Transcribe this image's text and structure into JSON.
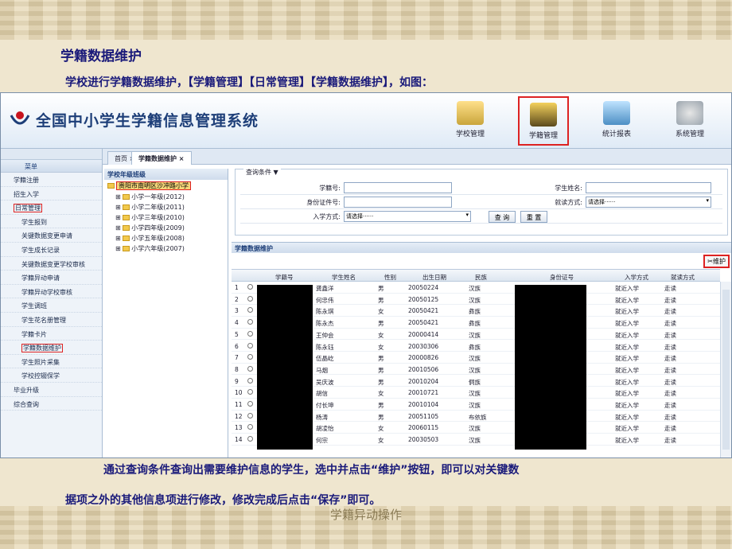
{
  "slide": {
    "title": "学籍数据维护",
    "subtitle": "学校进行学籍数据维护，【学籍管理】【日常管理】【学籍数据维护】，如图：",
    "body_line1": "通过查询条件查询出需要维护信息的学生，选中并点击“维护”按钮，即可以对关键数",
    "body_line2": "据项之外的其他信息项进行修改，修改完成后点击“保存”即可。",
    "footer": "学籍异动操作"
  },
  "app": {
    "title": "全国中小学生学籍信息管理系统",
    "top_nav": [
      {
        "label": "学校管理",
        "icon": "school-icon",
        "active": false
      },
      {
        "label": "学籍管理",
        "icon": "records-box-icon",
        "active": true
      },
      {
        "label": "统计报表",
        "icon": "stats-icon",
        "active": false
      },
      {
        "label": "系统管理",
        "icon": "settings-icon",
        "active": false
      }
    ],
    "tabs": [
      {
        "label": "首页"
      },
      {
        "label": "学籍数据维护"
      }
    ],
    "left_menu": {
      "title": "菜单",
      "items": [
        {
          "label": "学籍注册",
          "sub": false,
          "highlight": false
        },
        {
          "label": "招生入学",
          "sub": false,
          "highlight": false
        },
        {
          "label": "日常管理",
          "sub": false,
          "highlight": true
        },
        {
          "label": "学生报到",
          "sub": true,
          "highlight": false
        },
        {
          "label": "关键数据变更申请",
          "sub": true,
          "highlight": false
        },
        {
          "label": "学生成长记录",
          "sub": true,
          "highlight": false
        },
        {
          "label": "关键数据变更学校审核",
          "sub": true,
          "highlight": false
        },
        {
          "label": "学籍异动申请",
          "sub": true,
          "highlight": false
        },
        {
          "label": "学籍异动学校审核",
          "sub": true,
          "highlight": false
        },
        {
          "label": "学生调班",
          "sub": true,
          "highlight": false
        },
        {
          "label": "学生花名册管理",
          "sub": true,
          "highlight": false
        },
        {
          "label": "学籍卡片",
          "sub": true,
          "highlight": false
        },
        {
          "label": "学籍数据维护",
          "sub": true,
          "highlight": true
        },
        {
          "label": "学生照片采集",
          "sub": true,
          "highlight": false
        },
        {
          "label": "学校控辍保学",
          "sub": true,
          "highlight": false
        },
        {
          "label": "毕业升级",
          "sub": false,
          "highlight": false
        },
        {
          "label": "综合查询",
          "sub": false,
          "highlight": false
        }
      ]
    },
    "tree": {
      "title": "学校年级班级",
      "root": "贵阳市南明区沙冲路小学",
      "nodes": [
        "小学一年级(2012)",
        "小学二年级(2011)",
        "小学三年级(2010)",
        "小学四年级(2009)",
        "小学五年级(2008)",
        "小学六年级(2007)"
      ]
    },
    "query": {
      "legend": "查询条件",
      "student_no_label": "学籍号:",
      "student_name_label": "学生姓名:",
      "id_no_label": "身份证件号:",
      "study_mode_label": "就读方式:",
      "study_mode_value": "请选择······",
      "enroll_mode_label": "入学方式:",
      "enroll_mode_value": "请选择······",
      "query_button": "查 询",
      "reset_button": "重 置"
    },
    "grid": {
      "title": "学籍数据维护",
      "maintain_button": "维护",
      "columns": [
        "学籍号",
        "学生姓名",
        "性别",
        "出生日期",
        "民族",
        "身份证号",
        "入学方式",
        "就读方式"
      ],
      "rows": [
        {
          "n": "1",
          "name": "龚鑫洋",
          "sex": "男",
          "dob": "20050224",
          "nation": "汉族",
          "enroll": "就近入学",
          "mode": "走读"
        },
        {
          "n": "2",
          "name": "何忠伟",
          "sex": "男",
          "dob": "20050125",
          "nation": "汉族",
          "enroll": "就近入学",
          "mode": "走读"
        },
        {
          "n": "3",
          "name": "陈永琪",
          "sex": "女",
          "dob": "20050421",
          "nation": "彝族",
          "enroll": "就近入学",
          "mode": "走读"
        },
        {
          "n": "4",
          "name": "陈永杰",
          "sex": "男",
          "dob": "20050421",
          "nation": "彝族",
          "enroll": "就近入学",
          "mode": "走读"
        },
        {
          "n": "5",
          "name": "王仲会",
          "sex": "女",
          "dob": "20000414",
          "nation": "汉族",
          "enroll": "就近入学",
          "mode": "走读"
        },
        {
          "n": "6",
          "name": "陈永钰",
          "sex": "女",
          "dob": "20030306",
          "nation": "彝族",
          "enroll": "就近入学",
          "mode": "走读"
        },
        {
          "n": "7",
          "name": "伍晶屹",
          "sex": "男",
          "dob": "20000826",
          "nation": "汉族",
          "enroll": "就近入学",
          "mode": "走读"
        },
        {
          "n": "8",
          "name": "马烟",
          "sex": "男",
          "dob": "20010506",
          "nation": "汉族",
          "enroll": "就近入学",
          "mode": "走读"
        },
        {
          "n": "9",
          "name": "吴庆波",
          "sex": "男",
          "dob": "20010204",
          "nation": "侗族",
          "enroll": "就近入学",
          "mode": "走读"
        },
        {
          "n": "10",
          "name": "胡信",
          "sex": "女",
          "dob": "20010721",
          "nation": "汉族",
          "enroll": "就近入学",
          "mode": "走读"
        },
        {
          "n": "11",
          "name": "付长坤",
          "sex": "男",
          "dob": "20010104",
          "nation": "汉族",
          "enroll": "就近入学",
          "mode": "走读"
        },
        {
          "n": "12",
          "name": "杨涛",
          "sex": "男",
          "dob": "20051105",
          "nation": "布依族",
          "enroll": "就近入学",
          "mode": "走读"
        },
        {
          "n": "13",
          "name": "胡凌怡",
          "sex": "女",
          "dob": "20060115",
          "nation": "汉族",
          "enroll": "就近入学",
          "mode": "走读"
        },
        {
          "n": "14",
          "name": "何宗",
          "sex": "女",
          "dob": "20030503",
          "nation": "汉族",
          "enroll": "就近入学",
          "mode": "走读"
        }
      ]
    }
  }
}
